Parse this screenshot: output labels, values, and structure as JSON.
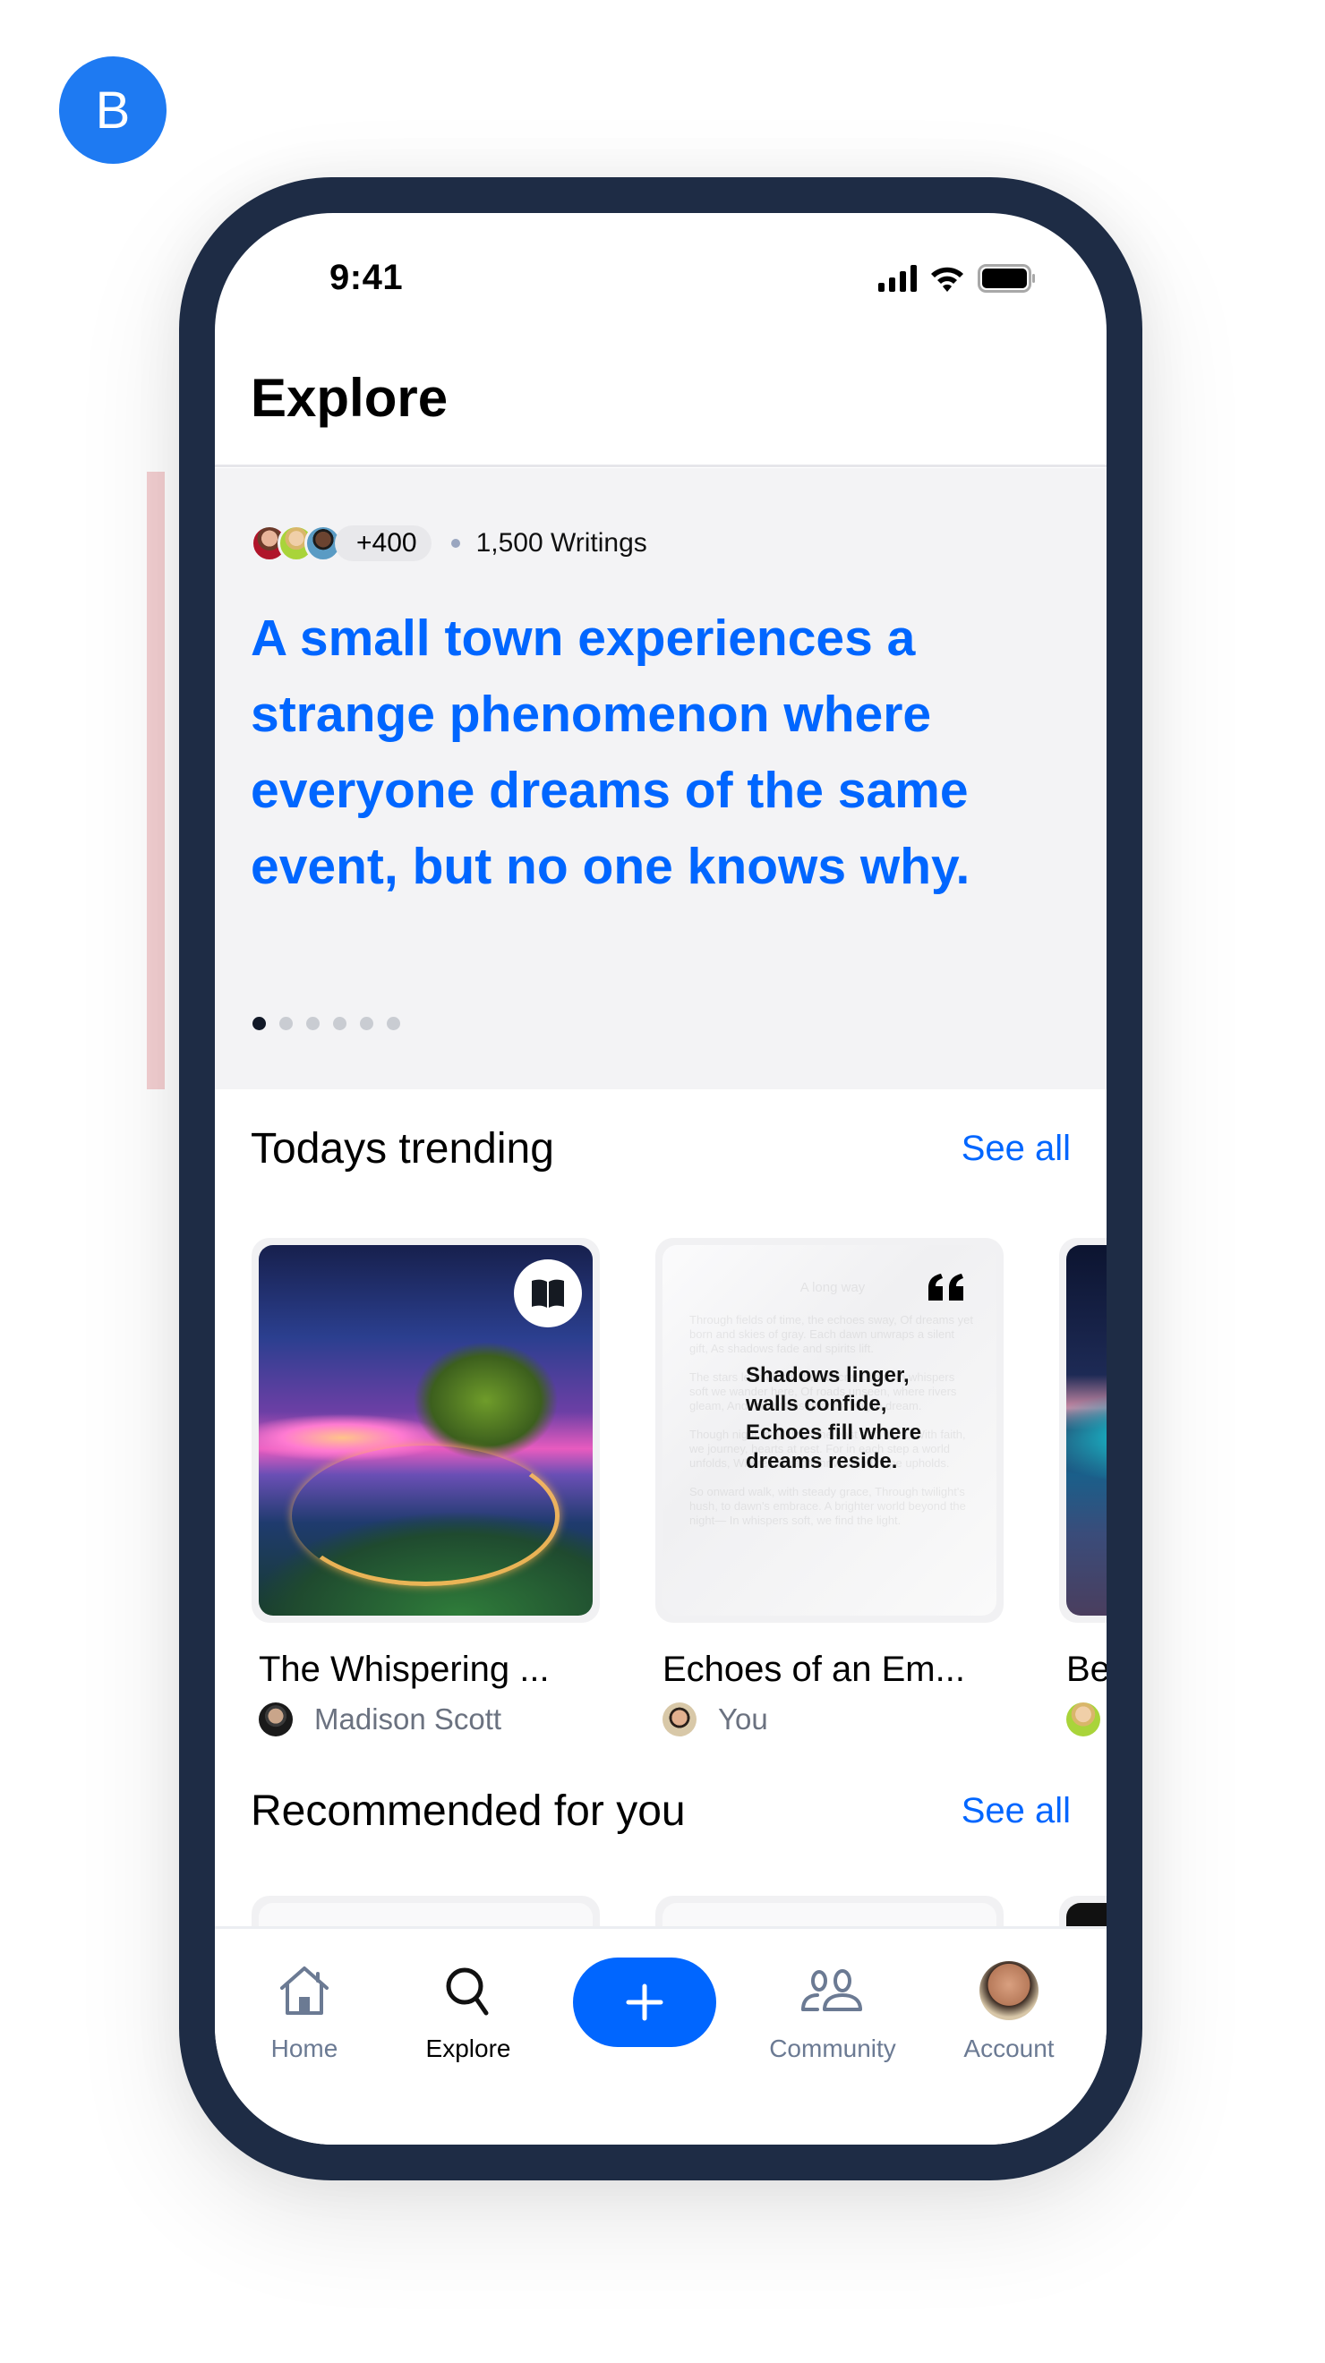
{
  "variant_badge": "B",
  "status_bar": {
    "time": "9:41",
    "icons": [
      "cellular-signal-icon",
      "wifi-icon",
      "battery-icon"
    ]
  },
  "header": {
    "title": "Explore"
  },
  "hero": {
    "avatar_count_label": "+400",
    "writings_label": "1,500 Writings",
    "prompt": "A small town experiences a strange phenomenon where everyone dreams of the same event, but no one knows why.",
    "pager": {
      "total": 6,
      "active_index": 0
    }
  },
  "trending": {
    "title": "Todays trending",
    "see_all": "See all",
    "cards": [
      {
        "title": "The Whispering ...",
        "author": "Madison Scott",
        "type": "image",
        "badge_icon": "open-book-icon"
      },
      {
        "title": "Echoes of an Em...",
        "author": "You",
        "type": "poem",
        "badge_icon": "quote-icon",
        "quote": "Shadows linger, walls confide, Echoes fill where dreams reside.",
        "background_poem_title": "A long way",
        "background_poem": [
          "Through fields of time, the echoes sway, Of dreams yet born and skies of gray. Each dawn unwraps a silent gift, As shadows fade and spirits lift.",
          "The stars lean close, their secrets near, In whispers soft we wander here, Of roads unseen, where rivers gleam, And mountains guard a fragile dream.",
          "Though night may cloak the east and west, With faith, we journey, hearts at rest. For in each step a world unfolds, Where courage thrives and hope upholds.",
          "So onward walk, with steady grace, Through twilight's hush, to dawn's embrace. A brighter world beyond the night— In whispers soft, we find the light."
        ]
      },
      {
        "title": "Be",
        "author": "",
        "type": "image"
      }
    ]
  },
  "recommended": {
    "title": "Recommended for you",
    "see_all": "See all"
  },
  "bottom_nav": {
    "items": [
      {
        "label": "Home",
        "icon": "home-icon",
        "active": false
      },
      {
        "label": "Explore",
        "icon": "search-icon",
        "active": true
      },
      {
        "label": "",
        "icon": "plus-icon",
        "active": false
      },
      {
        "label": "Community",
        "icon": "community-icon",
        "active": false
      },
      {
        "label": "Account",
        "icon": "account-avatar",
        "active": false
      }
    ]
  },
  "colors": {
    "accent": "#0066FF",
    "phone_frame": "#1E2C45",
    "hero_bg": "#F3F3F5",
    "muted_text": "#6B7A93"
  }
}
